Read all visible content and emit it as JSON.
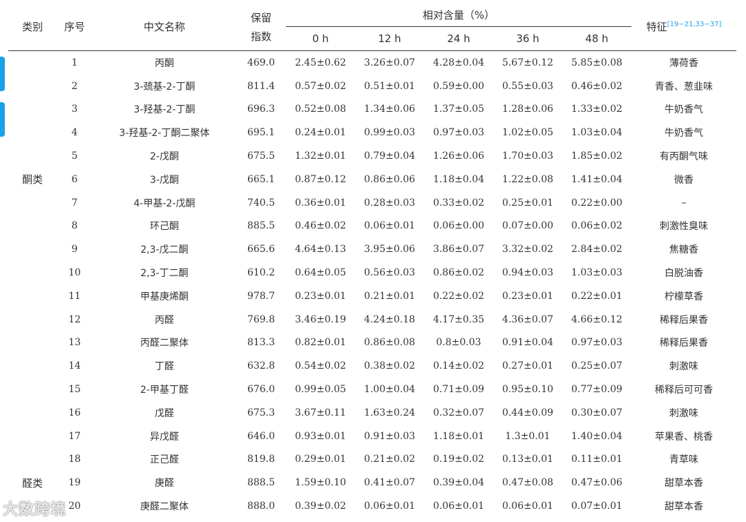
{
  "accent_color": "#1aa3e8",
  "header": {
    "category": "类别",
    "index": "序号",
    "name": "中文名称",
    "retention_line1": "保留",
    "retention_line2": "指数",
    "relative_content": "相对含量（%）",
    "time_points": [
      "0 h",
      "12 h",
      "24 h",
      "36 h",
      "48 h"
    ],
    "feature": "特征",
    "feature_ref": "[19−21,33−37]"
  },
  "categories": {
    "ketones": "酮类",
    "aldehydes": "醛类"
  },
  "rows": [
    {
      "no": "1",
      "name": "丙酮",
      "ri": "469.0",
      "v": [
        "2.45±0.62",
        "3.26±0.07",
        "4.28±0.04",
        "5.67±0.12",
        "5.85±0.08"
      ],
      "feature": "薄荷香"
    },
    {
      "no": "2",
      "name": "3-巯基-2-丁酮",
      "ri": "811.4",
      "v": [
        "0.57±0.02",
        "0.51±0.01",
        "0.59±0.00",
        "0.55±0.03",
        "0.46±0.02"
      ],
      "feature": "青香、葱韭味"
    },
    {
      "no": "3",
      "name": "3-羟基-2-丁酮",
      "ri": "696.3",
      "v": [
        "0.52±0.08",
        "1.34±0.06",
        "1.37±0.05",
        "1.28±0.06",
        "1.33±0.02"
      ],
      "feature": "牛奶香气"
    },
    {
      "no": "4",
      "name": "3-羟基-2-丁酮二聚体",
      "ri": "695.1",
      "v": [
        "0.24±0.01",
        "0.99±0.03",
        "0.97±0.03",
        "1.02±0.05",
        "1.03±0.04"
      ],
      "feature": "牛奶香气"
    },
    {
      "no": "5",
      "name": "2-戊酮",
      "ri": "675.5",
      "v": [
        "1.32±0.01",
        "0.79±0.04",
        "1.26±0.06",
        "1.70±0.03",
        "1.85±0.02"
      ],
      "feature": "有丙酮气味"
    },
    {
      "no": "6",
      "name": "3-戊酮",
      "ri": "665.1",
      "v": [
        "0.87±0.12",
        "0.86±0.06",
        "1.18±0.04",
        "1.22±0.08",
        "1.41±0.04"
      ],
      "feature": "微香"
    },
    {
      "no": "7",
      "name": "4-甲基-2-戊酮",
      "ri": "740.5",
      "v": [
        "0.36±0.01",
        "0.28±0.03",
        "0.33±0.02",
        "0.25±0.01",
        "0.22±0.00"
      ],
      "feature": "–"
    },
    {
      "no": "8",
      "name": "环己酮",
      "ri": "885.5",
      "v": [
        "0.46±0.02",
        "0.06±0.01",
        "0.06±0.00",
        "0.07±0.00",
        "0.06±0.02"
      ],
      "feature": "刺激性臭味"
    },
    {
      "no": "9",
      "name": "2,3-戊二酮",
      "ri": "665.6",
      "v": [
        "4.64±0.13",
        "3.95±0.06",
        "3.86±0.07",
        "3.32±0.02",
        "2.84±0.02"
      ],
      "feature": "焦糖香"
    },
    {
      "no": "10",
      "name": "2,3-丁二酮",
      "ri": "610.2",
      "v": [
        "0.64±0.05",
        "0.56±0.03",
        "0.86±0.02",
        "0.94±0.03",
        "1.03±0.03"
      ],
      "feature": "白脱油香"
    },
    {
      "no": "11",
      "name": "甲基庚烯酮",
      "ri": "978.7",
      "v": [
        "0.23±0.01",
        "0.21±0.01",
        "0.22±0.02",
        "0.23±0.01",
        "0.22±0.01"
      ],
      "feature": "柠檬草香"
    },
    {
      "no": "12",
      "name": "丙醛",
      "ri": "769.8",
      "v": [
        "3.46±0.19",
        "4.24±0.18",
        "4.17±0.35",
        "4.36±0.07",
        "4.66±0.12"
      ],
      "feature": "稀释后果香"
    },
    {
      "no": "13",
      "name": "丙醛二聚体",
      "ri": "813.3",
      "v": [
        "0.82±0.01",
        "0.86±0.08",
        "0.8±0.03",
        "0.91±0.04",
        "0.97±0.03"
      ],
      "feature": "稀释后果香"
    },
    {
      "no": "14",
      "name": "丁醛",
      "ri": "632.8",
      "v": [
        "0.54±0.02",
        "0.38±0.02",
        "0.14±0.02",
        "0.27±0.01",
        "0.25±0.07"
      ],
      "feature": "刺激味"
    },
    {
      "no": "15",
      "name": "2-甲基丁醛",
      "ri": "676.0",
      "v": [
        "0.99±0.05",
        "1.00±0.04",
        "0.71±0.09",
        "0.95±0.10",
        "0.77±0.09"
      ],
      "feature": "稀释后可可香"
    },
    {
      "no": "16",
      "name": "戊醛",
      "ri": "675.3",
      "v": [
        "3.67±0.11",
        "1.63±0.24",
        "0.32±0.07",
        "0.44±0.09",
        "0.30±0.07"
      ],
      "feature": "刺激味"
    },
    {
      "no": "17",
      "name": "异戊醛",
      "ri": "646.0",
      "v": [
        "0.93±0.01",
        "0.91±0.03",
        "1.18±0.01",
        "1.3±0.01",
        "1.40±0.04"
      ],
      "feature": "苹果香、桃香"
    },
    {
      "no": "18",
      "name": "正己醛",
      "ri": "819.8",
      "v": [
        "0.29±0.01",
        "0.21±0.02",
        "0.19±0.02",
        "0.13±0.01",
        "0.11±0.01"
      ],
      "feature": "青草味"
    },
    {
      "no": "19",
      "name": "庚醛",
      "ri": "888.5",
      "v": [
        "1.59±0.10",
        "0.41±0.07",
        "0.39±0.04",
        "0.47±0.08",
        "0.47±0.06"
      ],
      "feature": "甜草本香"
    },
    {
      "no": "20",
      "name": "庚醛二聚体",
      "ri": "888.0",
      "v": [
        "0.39±0.02",
        "0.06±0.01",
        "0.06±0.01",
        "0.06±0.01",
        "0.07±0.01"
      ],
      "feature": "甜草本香"
    }
  ],
  "watermark": "大数跨境"
}
